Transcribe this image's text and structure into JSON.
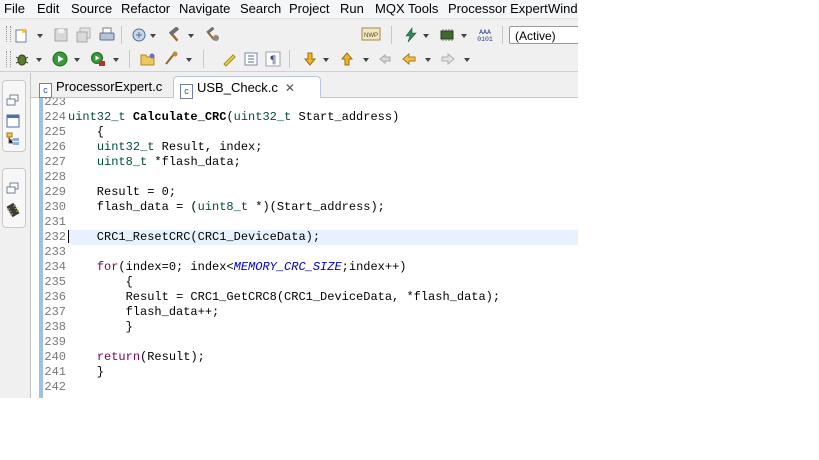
{
  "menu": [
    "File",
    "Edit",
    "Source",
    "Refactor",
    "Navigate",
    "Search",
    "Project",
    "Run",
    "MQX Tools",
    "Processor Expert",
    "Windo"
  ],
  "toolbar": {
    "config_combo": "(Active)",
    "icon_labels": {
      "nwp": "NWP",
      "binary": "0101"
    }
  },
  "tabs": [
    {
      "label": "ProcessorExpert.c",
      "active": false
    },
    {
      "label": "USB_Check.c",
      "active": true
    }
  ],
  "editor": {
    "line_numbers": [
      "223",
      "224",
      "225",
      "226",
      "227",
      "228",
      "229",
      "230",
      "231",
      "232",
      "233",
      "234",
      "235",
      "236",
      "237",
      "238",
      "239",
      "240",
      "241",
      "242"
    ],
    "current_line": "232",
    "colors": {
      "keyword": "#7f0055",
      "type": "#005032",
      "macro": "#0000c0",
      "current_line": "#e8f2fe",
      "ruler": "#9fc1e2"
    }
  }
}
